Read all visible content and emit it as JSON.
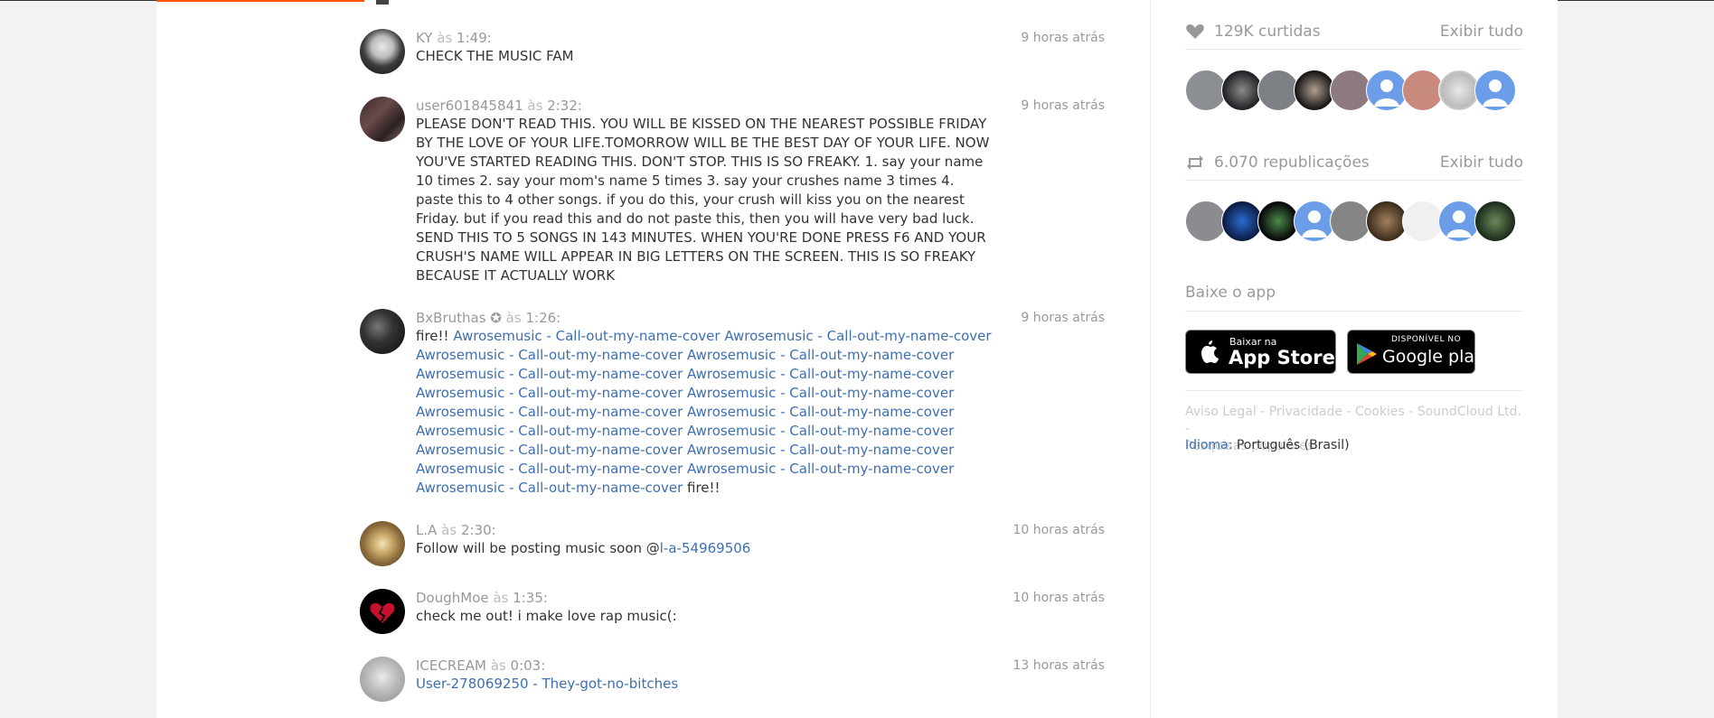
{
  "comments": [
    {
      "user": "KY",
      "at": "às",
      "time": "1:49",
      "ago": "9 horas atrás",
      "text": "CHECK THE MUSIC FAM"
    },
    {
      "user": "user601845841",
      "at": "às",
      "time": "2:32",
      "ago": "9 horas atrás",
      "text": "PLEASE DON'T READ THIS. YOU WILL BE KISSED ON THE NEAREST POSSIBLE FRIDAY BY THE LOVE OF YOUR LIFE.TOMORROW WILL BE THE BEST DAY OF YOUR LIFE. NOW YOU'VE STARTED READING THIS. DON'T STOP. THIS IS SO FREAKY. 1. say your name 10 times 2. say your mom's name 5 times 3. say your crushes name 3 times 4. paste this to 4 other songs. if you do this, your crush will kiss you on the nearest Friday. but if you read this and do not paste this, then you will have very bad luck. SEND THIS TO 5 SONGS IN 143 MINUTES. WHEN YOU'RE DONE PRESS F6 AND YOUR CRUSH'S NAME WILL APPEAR IN BIG LETTERS ON THE SCREEN. THIS IS SO FREAKY BECAUSE IT ACTUALLY WORK"
    },
    {
      "user": "BxBruthas",
      "badge": "✪",
      "at": "às",
      "time": "1:26",
      "ago": "9 horas atrás",
      "prefix": "fire!!",
      "link": "Awrosemusic - Call-out-my-name-cover Awrosemusic - Call-out-my-name-cover Awrosemusic - Call-out-my-name-cover Awrosemusic - Call-out-my-name-cover Awrosemusic - Call-out-my-name-cover Awrosemusic - Call-out-my-name-cover Awrosemusic - Call-out-my-name-cover Awrosemusic - Call-out-my-name-cover Awrosemusic - Call-out-my-name-cover Awrosemusic - Call-out-my-name-cover Awrosemusic - Call-out-my-name-cover Awrosemusic - Call-out-my-name-cover Awrosemusic - Call-out-my-name-cover Awrosemusic - Call-out-my-name-cover Awrosemusic - Call-out-my-name-cover Awrosemusic - Call-out-my-name-cover Awrosemusic - Call-out-my-name-cover",
      "suffix": "fire!!"
    },
    {
      "user": "L.A",
      "at": "às",
      "time": "2:30",
      "ago": "10 horas atrás",
      "prefix": "Follow will be posting music soon @",
      "link": "l-a-54969506"
    },
    {
      "user": "DoughMoe",
      "at": "às",
      "time": "1:35",
      "ago": "10 horas atrás",
      "text": "check me out! i make love rap music(:"
    },
    {
      "user": "ICECREAM",
      "at": "às",
      "time": "0:03",
      "ago": "13 horas atrás",
      "link": "User-278069250 - They-got-no-bitches"
    }
  ],
  "sidebar": {
    "likes": {
      "label": "129K curtidas",
      "view_all": "Exibir tudo",
      "icon": "heart-icon"
    },
    "reposts": {
      "label": "6.070 republicações",
      "view_all": "Exibir tudo",
      "icon": "repost-icon"
    },
    "app": {
      "title": "Baixe o app",
      "appstore_small": "Baixar na",
      "appstore_big": "App Store",
      "play_small": "DISPONÍVEL NO",
      "play_big": "Google play"
    },
    "footer": {
      "links": [
        "Aviso Legal",
        "Privacidade",
        "Cookies",
        "SoundCloud Ltd.",
        "Pesquisas populares"
      ],
      "lang_label": "Idioma:",
      "lang_value": "Português (Brasil)"
    }
  },
  "colors": {
    "accent": "#ff5500",
    "link": "#3d6fb2",
    "muted": "#999999"
  }
}
